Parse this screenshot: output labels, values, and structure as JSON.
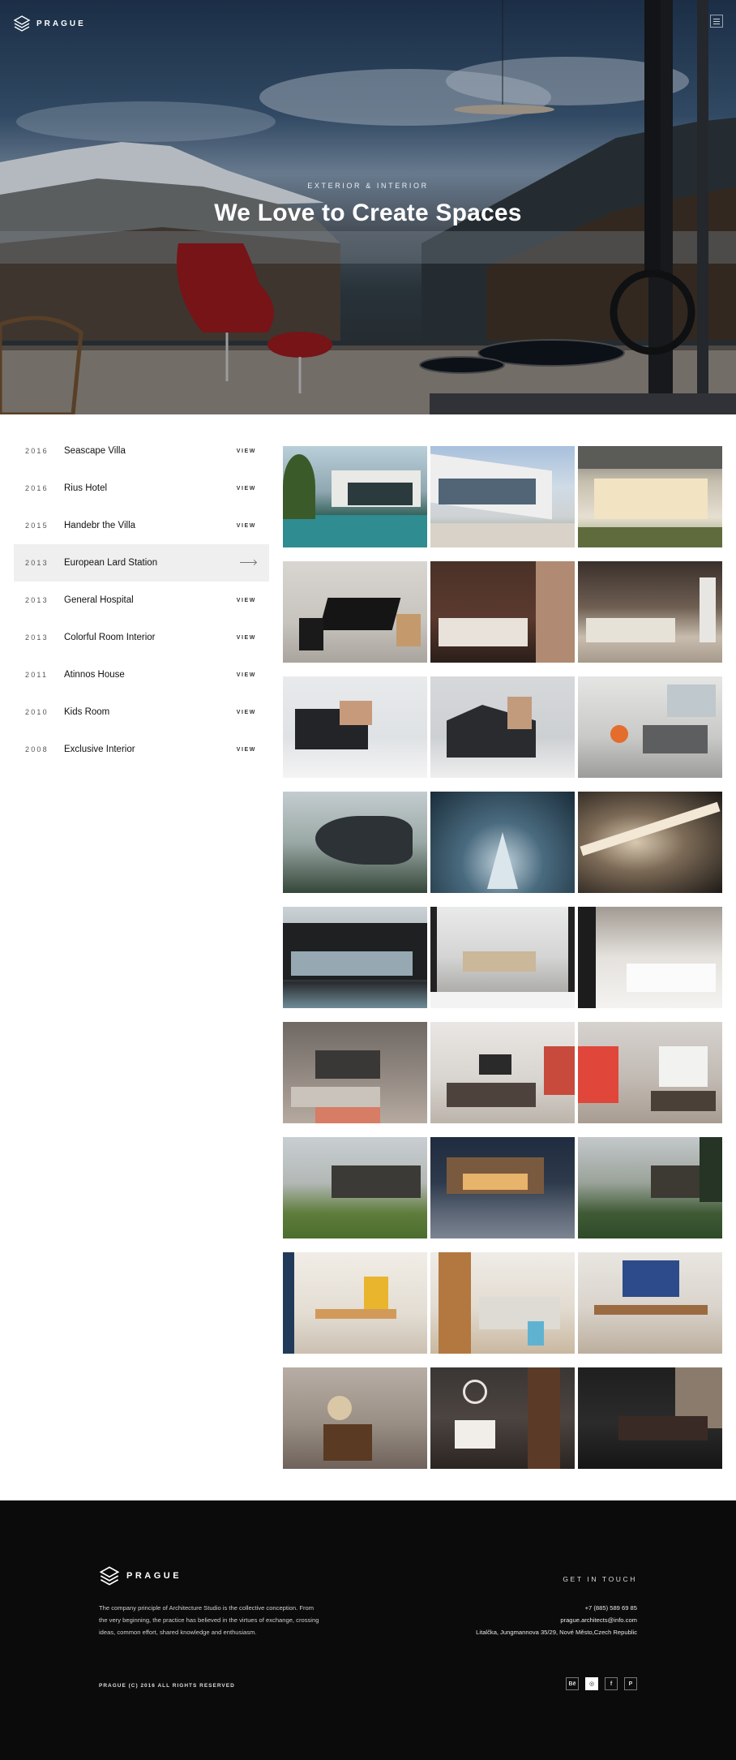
{
  "brand": {
    "name": "PRAGUE"
  },
  "header": {
    "menu_icon": "hamburger-icon"
  },
  "hero": {
    "subtitle": "EXTERIOR & INTERIOR",
    "title": "We Love to Create Spaces"
  },
  "projects": [
    {
      "year": "2016",
      "name": "Seascape Villa",
      "action": "VIEW"
    },
    {
      "year": "2016",
      "name": "Rius Hotel",
      "action": "VIEW"
    },
    {
      "year": "2015",
      "name": "Handebr the Villa",
      "action": "VIEW"
    },
    {
      "year": "2013",
      "name": "European Lard Station",
      "action": ""
    },
    {
      "year": "2013",
      "name": "General Hospital",
      "action": "VIEW"
    },
    {
      "year": "2013",
      "name": "Colorful Room Interior",
      "action": "VIEW"
    },
    {
      "year": "2011",
      "name": "Atinnos House",
      "action": "VIEW"
    },
    {
      "year": "2010",
      "name": "Kids Room",
      "action": "VIEW"
    },
    {
      "year": "2008",
      "name": "Exclusive Interior",
      "action": "VIEW"
    }
  ],
  "footer": {
    "description": "The company principle of Architecture Studio is the collective conception. From the very beginning, the practice has believed in the virtues of exchange, crossing ideas, common effort, shared knowledge and enthusiasm.",
    "get_in_touch": "GET IN TOUCH",
    "phone": "+7 (885) 589 69 85",
    "email": "prague.architects@info.com",
    "address": "Litalčka, Jungmannova 35/29, Nové Město,Czech Republic",
    "copyright": "PRAGUE (C) 2016 ALL RIGHTS RESERVED",
    "social": [
      {
        "label": "Bē",
        "icon": "behance-icon"
      },
      {
        "label": "◎",
        "icon": "dribbble-icon"
      },
      {
        "label": "f",
        "icon": "facebook-icon"
      },
      {
        "label": "P",
        "icon": "pinterest-icon"
      }
    ]
  }
}
